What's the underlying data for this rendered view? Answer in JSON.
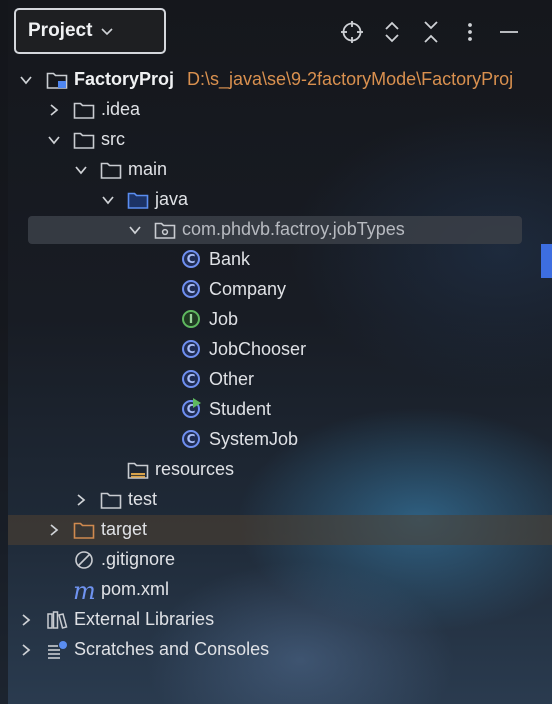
{
  "header": {
    "title": "Project",
    "icons": [
      "locate-icon",
      "expand-icon",
      "collapse-icon",
      "more-icon",
      "minimize-icon"
    ]
  },
  "tree": {
    "root": {
      "name": "FactoryProj",
      "path": "D:\\s_java\\se\\9-2factoryMode\\FactoryProj"
    },
    "idea": ".idea",
    "src": "src",
    "main": "main",
    "java": "java",
    "package": "com.phdvb.factroy.jobTypes",
    "classes": [
      "Bank",
      "Company",
      "Job",
      "JobChooser",
      "Other",
      "Student",
      "SystemJob"
    ],
    "resources": "resources",
    "test": "test",
    "target": "target",
    "gitignore": ".gitignore",
    "pom": "pom.xml",
    "external_libraries": "External Libraries",
    "scratches": "Scratches and Consoles"
  },
  "colors": {
    "folder_icon": "#c9ccd1",
    "source_folder_icon": "#5a8df0",
    "class_icon": "#6f8ff0",
    "interface_icon": "#5fb85f",
    "path_text": "#d9904f",
    "target_folder": "#d08a4f"
  }
}
